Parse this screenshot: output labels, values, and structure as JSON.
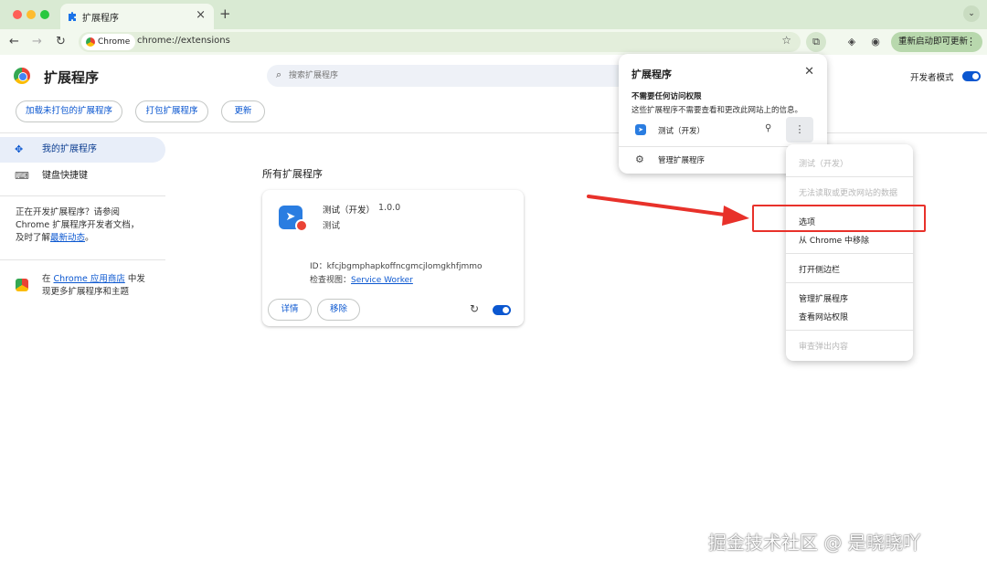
{
  "tab": {
    "title": "扩展程序",
    "icon": "puzzle-icon"
  },
  "toolbar": {
    "site_chip": "Chrome",
    "url": "chrome://extensions",
    "update_button": "重新启动即可更新"
  },
  "page": {
    "title": "扩展程序",
    "search_placeholder": "搜索扩展程序",
    "dev_mode_label": "开发者模式",
    "dev_mode_on": true
  },
  "actions": {
    "load_unpacked": "加载未打包的扩展程序",
    "pack": "打包扩展程序",
    "update": "更新"
  },
  "sidebar": {
    "items": [
      {
        "label": "我的扩展程序",
        "icon": "puzzle-icon",
        "active": true
      },
      {
        "label": "键盘快捷键",
        "icon": "keyboard-icon",
        "active": false
      }
    ],
    "dev_line1": "正在开发扩展程序？请参阅",
    "dev_line2": "Chrome 扩展程序开发者文档，",
    "dev_line3_prefix": "及时了解",
    "dev_link": "最新动态",
    "dev_line3_suffix": "。",
    "store_prefix": "在 ",
    "store_link": "Chrome 应用商店",
    "store_suffix": " 中发",
    "store_line2": "现更多扩展程序和主题"
  },
  "main": {
    "section_title": "所有扩展程序",
    "extension": {
      "name": "测试（开发）",
      "version": "1.0.0",
      "description": "测试",
      "id": "ID：kfcjbgmphapkoffncgmcjlomgkhfjmmo",
      "inspect_label": "检查视图：",
      "inspect_link": "Service Worker",
      "details_button": "详情",
      "remove_button": "移除",
      "enabled": true
    }
  },
  "popup": {
    "title": "扩展程序",
    "subtitle": "不需要任何访问权限",
    "description": "这些扩展程序不需要查看和更改此网站上的信息。",
    "ext_name": "测试（开发）",
    "manage": "管理扩展程序"
  },
  "context_menu": {
    "header": "测试（开发）",
    "no_access": "无法读取或更改网站的数据",
    "options": "选项",
    "remove": "从 Chrome 中移除",
    "side_panel": "打开侧边栏",
    "manage": "管理扩展程序",
    "site_permissions": "查看网站权限",
    "inspect_popup": "审查弹出内容"
  },
  "watermark": "掘金技术社区 @ 是晓晓吖",
  "colors": {
    "accent": "#0b57d0",
    "annotation": "#e8312a",
    "tab_strip": "#d9ead3"
  }
}
